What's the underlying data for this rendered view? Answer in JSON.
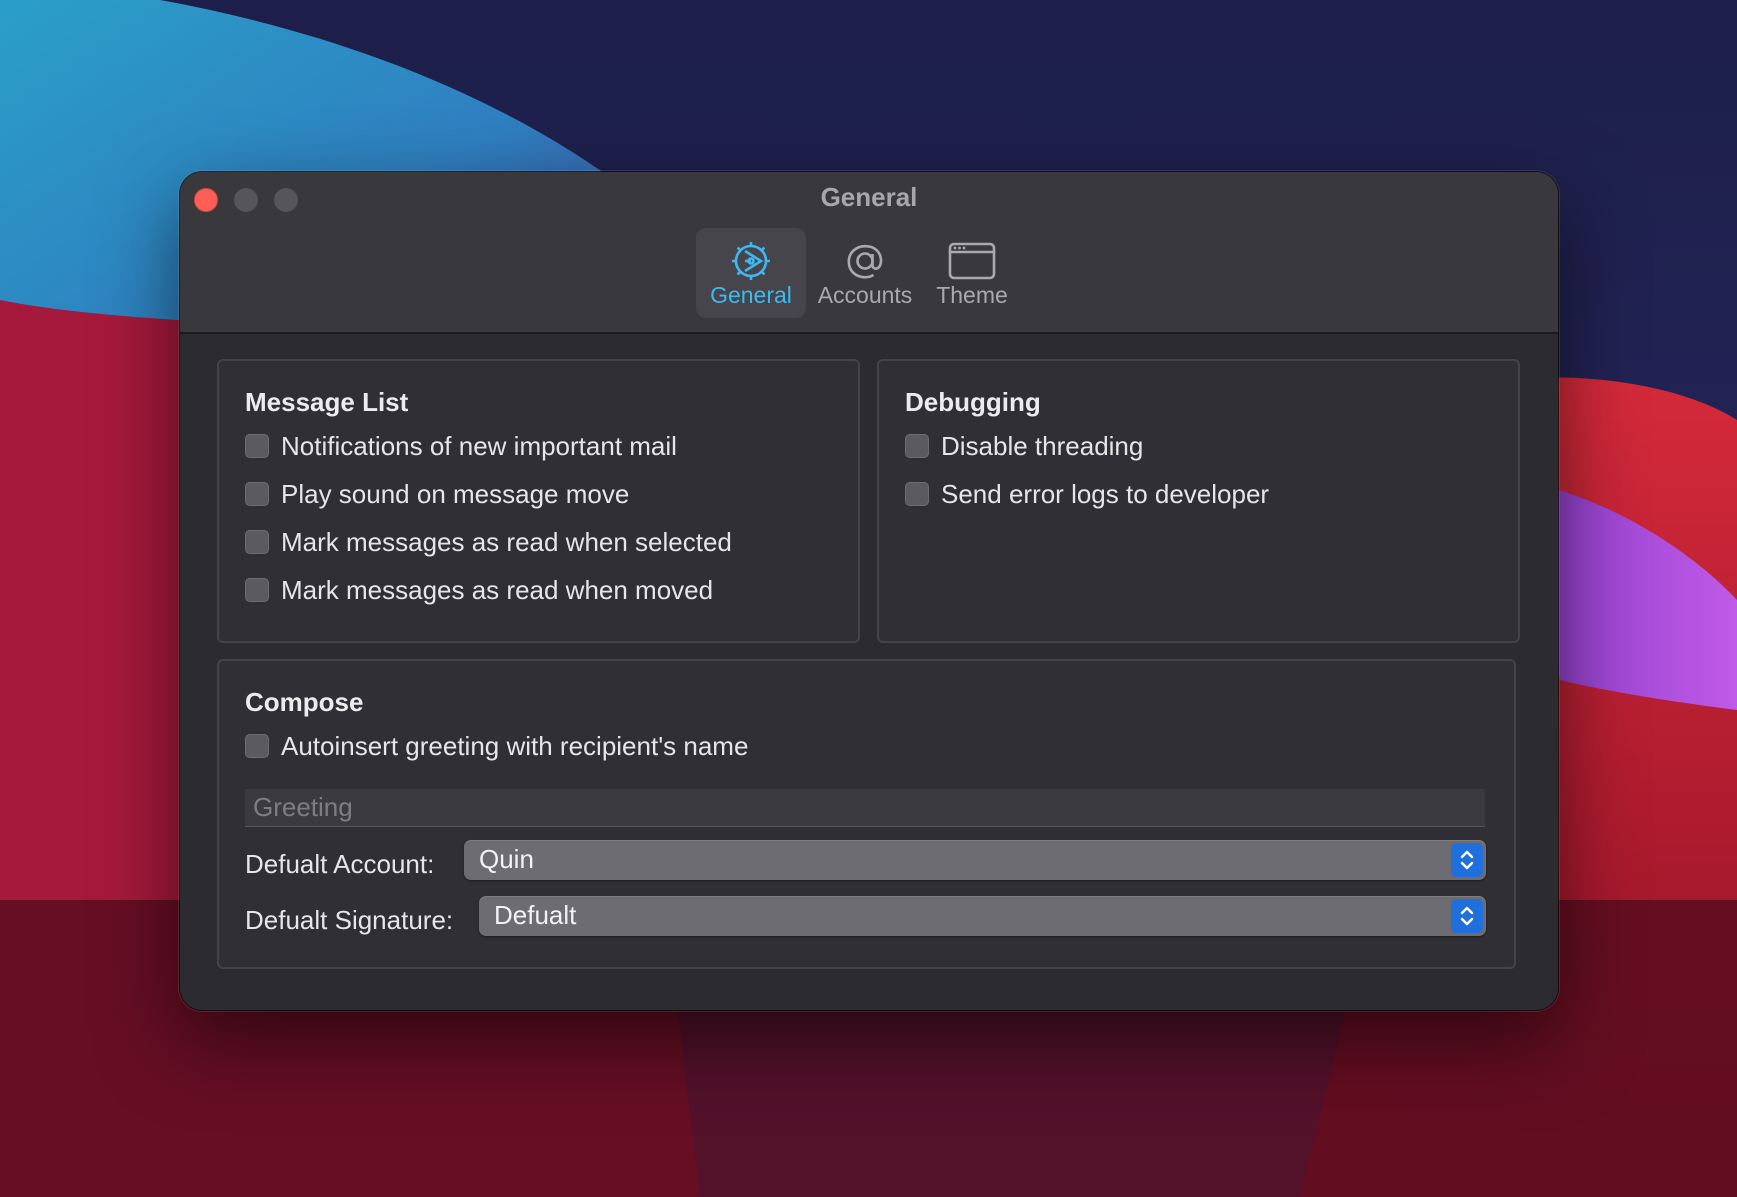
{
  "window": {
    "title": "General"
  },
  "toolbar": {
    "tabs": [
      {
        "label": "General",
        "icon": "gear-icon",
        "active": true
      },
      {
        "label": "Accounts",
        "icon": "at-sign-icon",
        "active": false
      },
      {
        "label": "Theme",
        "icon": "window-icon",
        "active": false
      }
    ]
  },
  "message_list": {
    "title": "Message List",
    "options": [
      {
        "label": "Notifications of new important mail",
        "checked": false
      },
      {
        "label": "Play sound on message move",
        "checked": false
      },
      {
        "label": "Mark messages as read when selected",
        "checked": false
      },
      {
        "label": "Mark messages as read when moved",
        "checked": false
      }
    ]
  },
  "debugging": {
    "title": "Debugging",
    "options": [
      {
        "label": "Disable threading",
        "checked": false
      },
      {
        "label": "Send error logs to developer",
        "checked": false
      }
    ]
  },
  "compose": {
    "title": "Compose",
    "autoinsert": {
      "label": "Autoinsert greeting with recipient's name",
      "checked": false
    },
    "greeting_placeholder": "Greeting",
    "greeting_value": "",
    "default_account": {
      "label": "Defualt Account:",
      "value": "Quin"
    },
    "default_signature": {
      "label": "Defualt Signature:",
      "value": "Defualt"
    }
  },
  "colors": {
    "accent": "#3fb8f0",
    "close_button": "#ff5f57",
    "stepper": "#1f6fdc",
    "window_bg": "#2b2b30"
  }
}
